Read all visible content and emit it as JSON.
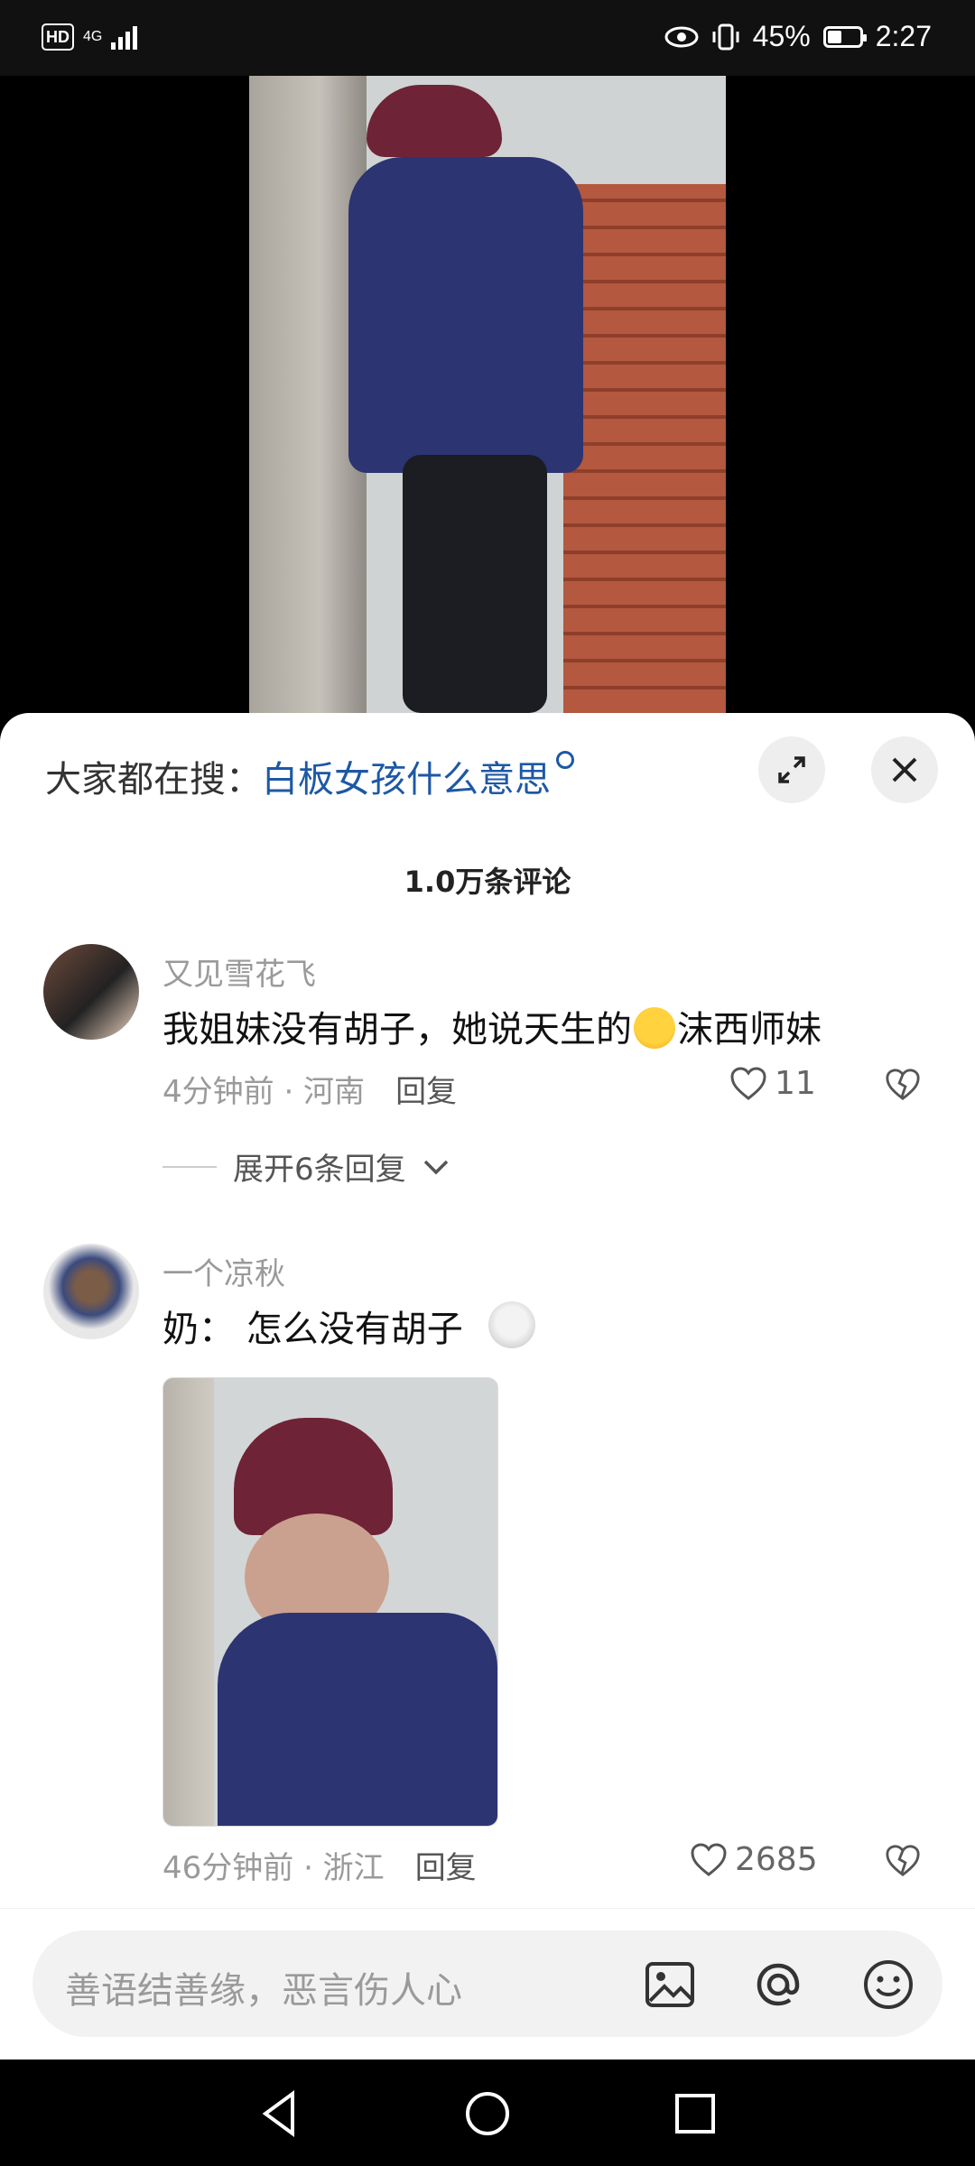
{
  "status_bar": {
    "hd": "HD",
    "network": "4G",
    "battery": "45%",
    "battery_level": 0.45,
    "time": "2:27"
  },
  "search": {
    "prefix": "大家都在搜：",
    "term": "白板女孩什么意思"
  },
  "comments_header": {
    "title": "1.0万条评论"
  },
  "comments": [
    {
      "user": "又见雪花飞",
      "text_before": "我姐妹没有胡子，她说天生的",
      "text_after": "沫西师妹",
      "meta": "4分钟前 · 河南",
      "reply_label": "回复",
      "likes": "11",
      "expand_label": "展开6条回复"
    },
    {
      "user": "一个凉秋",
      "text": "奶： 怎么没有胡子",
      "meta": "46分钟前 · 浙江",
      "reply_label": "回复",
      "likes": "2685"
    }
  ],
  "input": {
    "placeholder": "善语结善缘，恶言伤人心"
  },
  "colors": {
    "accent": "#1d58a6",
    "sheet_bg": "#ffffff",
    "muted": "#9a9a9a"
  },
  "icons": [
    "eye-icon",
    "vibrate-icon",
    "battery-icon",
    "expand-icon",
    "close-icon",
    "heart-icon",
    "dislike-icon",
    "chevron-down-icon",
    "image-icon",
    "at-icon",
    "emoji-icon",
    "back-nav-icon",
    "home-nav-icon",
    "recents-nav-icon"
  ]
}
